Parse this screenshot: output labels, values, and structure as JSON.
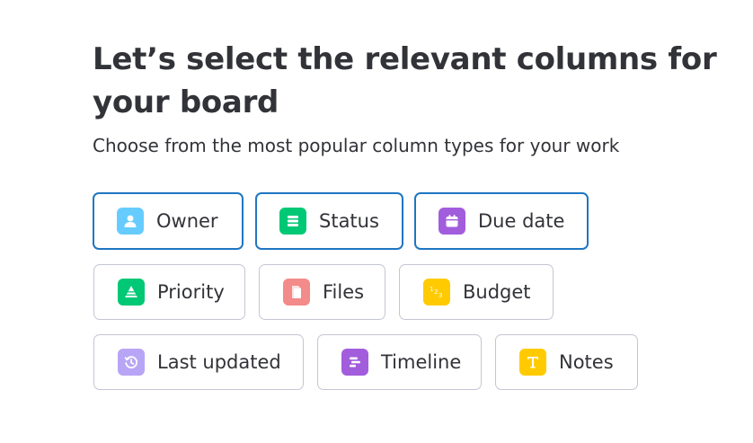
{
  "heading": {
    "title": "Let’s select the relevant columns for your board",
    "subtitle": "Choose from the most popular column types for your work"
  },
  "columns": [
    {
      "label": "Owner",
      "icon": "person-icon",
      "color": "#66ccff",
      "selected": true
    },
    {
      "label": "Status",
      "icon": "status-list-icon",
      "color": "#00c875",
      "selected": true
    },
    {
      "label": "Due date",
      "icon": "calendar-icon",
      "color": "#a25ddc",
      "selected": true
    },
    {
      "label": "Priority",
      "icon": "priority-triangle-icon",
      "color": "#00c875",
      "selected": false
    },
    {
      "label": "Files",
      "icon": "file-icon",
      "color": "#f28b89",
      "selected": false
    },
    {
      "label": "Budget",
      "icon": "numbers-icon",
      "color": "#ffcb00",
      "selected": false
    },
    {
      "label": "Last updated",
      "icon": "clock-icon",
      "color": "#b8a5f5",
      "selected": false
    },
    {
      "label": "Timeline",
      "icon": "timeline-icon",
      "color": "#a25ddc",
      "selected": false
    },
    {
      "label": "Notes",
      "icon": "text-icon",
      "color": "#ffcb00",
      "selected": false
    }
  ],
  "colors": {
    "selected_border": "#1f76c2",
    "default_border": "#c3c6d4",
    "text": "#323338"
  }
}
